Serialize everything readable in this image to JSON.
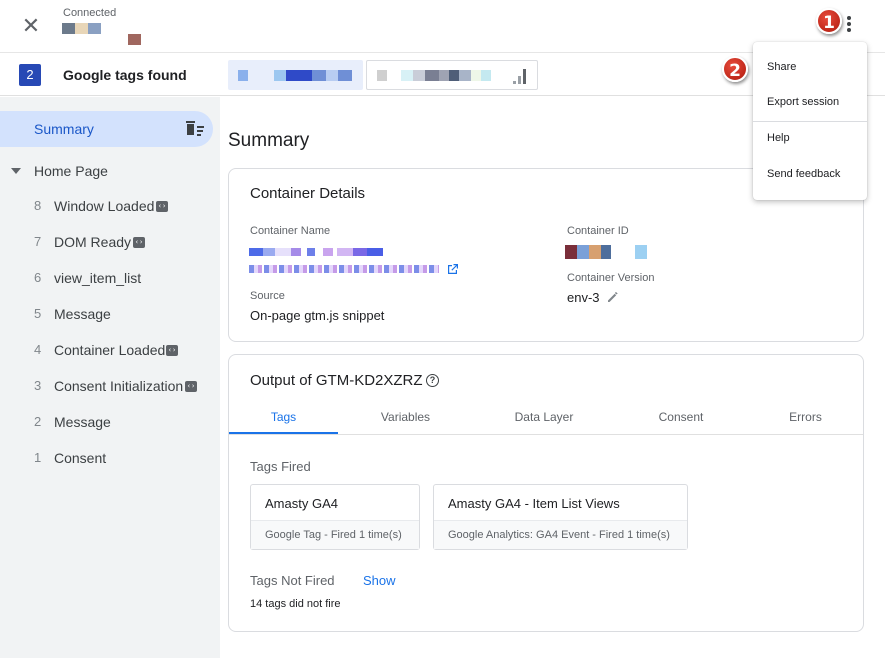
{
  "topbar": {
    "close_icon": "close-icon",
    "connection_label": "Connected",
    "more_icon": "more-vert-icon"
  },
  "markers": [
    "1",
    "2"
  ],
  "tagbar": {
    "count": "2",
    "label": "Google tags found"
  },
  "sidebar": {
    "summary_label": "Summary",
    "page_label": "Home Page",
    "events": [
      {
        "num": "8",
        "label": "Window Loaded",
        "has_code_icon": true
      },
      {
        "num": "7",
        "label": "DOM Ready",
        "has_code_icon": true
      },
      {
        "num": "6",
        "label": "view_item_list",
        "has_code_icon": false
      },
      {
        "num": "5",
        "label": "Message",
        "has_code_icon": false
      },
      {
        "num": "4",
        "label": "Container Loaded",
        "has_code_icon": true
      },
      {
        "num": "3",
        "label": "Consent Initialization",
        "has_code_icon": true
      },
      {
        "num": "2",
        "label": "Message",
        "has_code_icon": false
      },
      {
        "num": "1",
        "label": "Consent",
        "has_code_icon": false
      }
    ]
  },
  "main": {
    "title": "Summary",
    "container_details": {
      "title": "Container Details",
      "name_label": "Container Name",
      "source_label": "Source",
      "source_value": "On-page gtm.js snippet",
      "id_label": "Container ID",
      "version_label": "Container Version",
      "version_value": "env-3"
    },
    "output": {
      "title": "Output of GTM-KD2XZRZ",
      "tabs": [
        "Tags",
        "Variables",
        "Data Layer",
        "Consent",
        "Errors"
      ],
      "active_tab": "Tags",
      "tags_fired_label": "Tags Fired",
      "fired_tags": [
        {
          "name": "Amasty GA4",
          "detail": "Google Tag - Fired 1 time(s)"
        },
        {
          "name": "Amasty GA4 - Item List Views",
          "detail": "Google Analytics: GA4 Event - Fired 1 time(s)"
        }
      ],
      "not_fired_label": "Tags Not Fired",
      "show_label": "Show",
      "not_fired_count_text": "14 tags did not fire"
    }
  },
  "menu": {
    "items": [
      "Share",
      "Export session",
      "Help",
      "Send feedback"
    ]
  },
  "colors": {
    "accent": "#1a73e8",
    "badge": "#2749b5",
    "summary_highlight": "#d3e2fd",
    "sidebar_bg": "#f1f3f4",
    "marker_red": "#c0281a"
  }
}
